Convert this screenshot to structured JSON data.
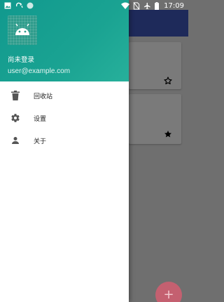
{
  "status_bar": {
    "time": "17:09",
    "left_icons": [
      "image-icon",
      "sync-icon",
      "circle-icon"
    ],
    "right_icons": [
      "wifi-icon",
      "no-sim-icon",
      "airplane-icon",
      "battery-icon"
    ]
  },
  "drawer": {
    "header": {
      "user_name": "尚未登录",
      "user_email": "user@example.com",
      "gradient_start": "#11998e",
      "gradient_end": "#27b09b"
    },
    "items": [
      {
        "label": "回收站",
        "icon": "trash-icon"
      },
      {
        "label": "设置",
        "icon": "settings-icon"
      },
      {
        "label": "关于",
        "icon": "person-icon"
      }
    ]
  },
  "background": {
    "app_bar_color": "#1e2a5a",
    "cards": [
      {
        "starred": false,
        "icon": "star-outline-icon"
      },
      {
        "starred": true,
        "icon": "star-filled-icon"
      }
    ],
    "fab_label": "+"
  }
}
